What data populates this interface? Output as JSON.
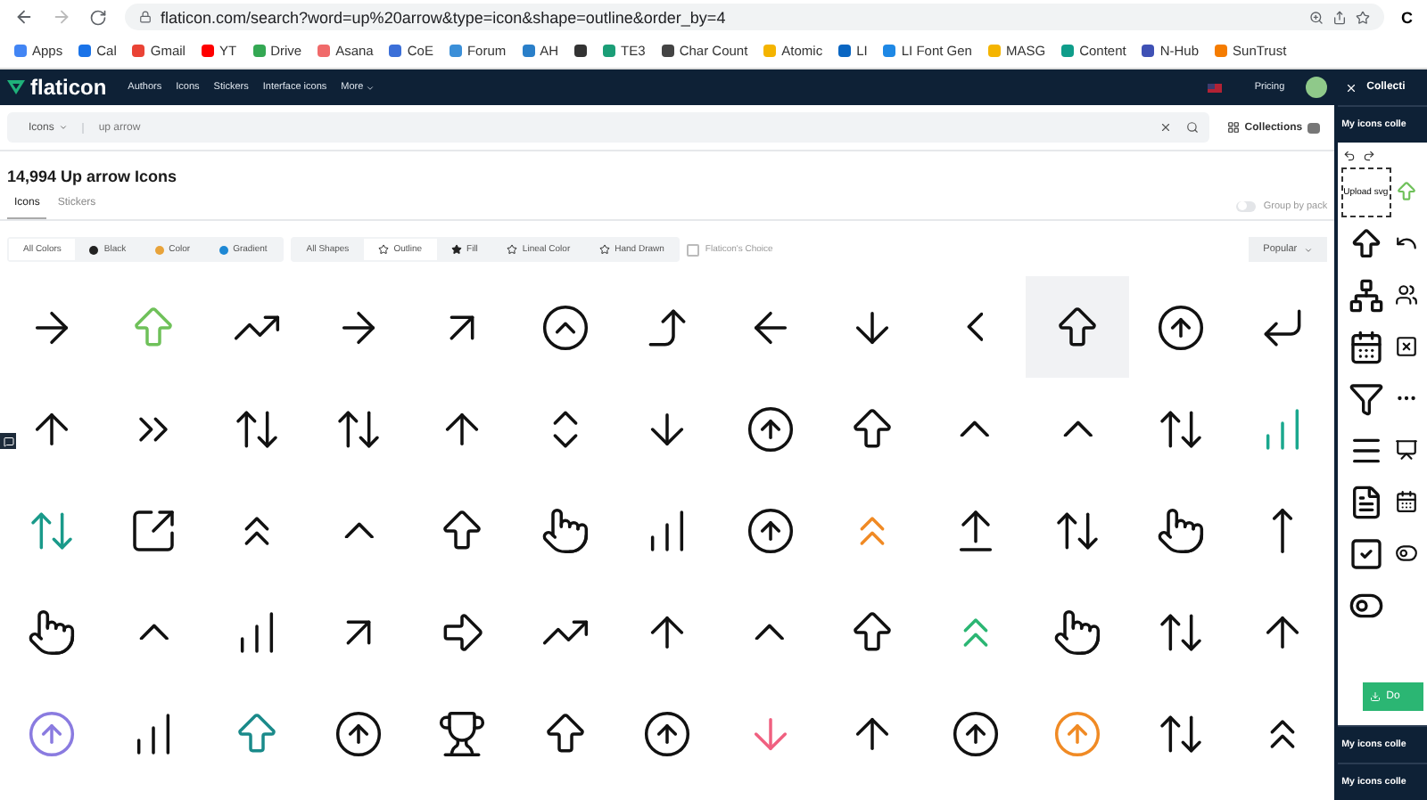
{
  "browser": {
    "url": "flaticon.com/search?word=up%20arrow&type=icon&shape=outline&order_by=4",
    "profile": "C",
    "bookmarks": [
      {
        "label": "Apps",
        "color": "#4285f4"
      },
      {
        "label": "Cal",
        "color": "#1a73e8"
      },
      {
        "label": "Gmail",
        "color": "#ea4335"
      },
      {
        "label": "YT",
        "color": "#ff0000"
      },
      {
        "label": "Drive",
        "color": "#34a853"
      },
      {
        "label": "Asana",
        "color": "#f06a6a"
      },
      {
        "label": "CoE",
        "color": "#3b6fd8"
      },
      {
        "label": "Forum",
        "color": "#3b8fd8"
      },
      {
        "label": "AH",
        "color": "#2a7fc9"
      },
      {
        "color": "#333333"
      },
      {
        "label": "TE3",
        "color": "#1b9e77"
      },
      {
        "label": "Char Count",
        "color": "#444444"
      },
      {
        "label": "Atomic",
        "color": "#f4b400"
      },
      {
        "label": "LI",
        "color": "#0a66c2"
      },
      {
        "label": "LI Font Gen",
        "color": "#1e88e5"
      },
      {
        "label": "MASG",
        "color": "#f4b400"
      },
      {
        "label": "Content",
        "color": "#0f9d8a"
      },
      {
        "label": "N-Hub",
        "color": "#3f51b5"
      },
      {
        "label": "SunTrust",
        "color": "#f57c00"
      }
    ]
  },
  "nav": {
    "logo": "flaticon",
    "links": [
      "Authors",
      "Icons",
      "Stickers",
      "Interface icons",
      "More"
    ],
    "pricing": "Pricing"
  },
  "search": {
    "type": "Icons",
    "value": "up arrow",
    "collections": "Collections"
  },
  "heading": "14,994 Up arrow Icons",
  "tabs": [
    {
      "label": "Icons",
      "selected": true
    },
    {
      "label": "Stickers",
      "selected": false
    }
  ],
  "group_by_pack": {
    "label": "Group by pack",
    "on": false
  },
  "color_filters": [
    {
      "label": "All Colors",
      "selected": true
    },
    {
      "label": "Black",
      "selected": false,
      "color": "#222222"
    },
    {
      "label": "Color",
      "selected": false,
      "color": "#e8a33a"
    },
    {
      "label": "Gradient",
      "selected": false,
      "color": "#1e88d4"
    }
  ],
  "shape_filters": [
    {
      "label": "All Shapes",
      "selected": false
    },
    {
      "label": "Outline",
      "selected": true,
      "kind": "star-outline"
    },
    {
      "label": "Fill",
      "selected": false,
      "kind": "star-fill"
    },
    {
      "label": "Lineal Color",
      "selected": false,
      "kind": "star-outline"
    },
    {
      "label": "Hand Drawn",
      "selected": false,
      "kind": "star-outline"
    }
  ],
  "flaticons_choice": {
    "label": "Flaticon's Choice",
    "checked": false
  },
  "sort": "Popular",
  "results": [
    {
      "kind": "arrow-right",
      "selected": false
    },
    {
      "kind": "big-up",
      "color": "#6fc15a",
      "selected": false
    },
    {
      "kind": "trend",
      "selected": false
    },
    {
      "kind": "arrow-right",
      "selected": false
    },
    {
      "kind": "diag",
      "selected": false
    },
    {
      "kind": "circle-chevron",
      "selected": false
    },
    {
      "kind": "swirl",
      "selected": false
    },
    {
      "kind": "arrow-left",
      "selected": false
    },
    {
      "kind": "arrow-down",
      "selected": false
    },
    {
      "kind": "chevron-left",
      "selected": false
    },
    {
      "kind": "big-up",
      "selected": true
    },
    {
      "kind": "circle-up",
      "selected": false
    },
    {
      "kind": "corner",
      "selected": false
    },
    {
      "kind": "arrow-up",
      "selected": false
    },
    {
      "kind": "chevrons-right",
      "selected": false
    },
    {
      "kind": "up-down",
      "selected": false
    },
    {
      "kind": "up-down",
      "selected": false
    },
    {
      "kind": "arrow-up",
      "selected": false
    },
    {
      "kind": "chevrons-up-down",
      "selected": false
    },
    {
      "kind": "arrow-down",
      "selected": false
    },
    {
      "kind": "circle-up",
      "selected": false
    },
    {
      "kind": "big-up",
      "selected": false
    },
    {
      "kind": "chevron-up",
      "selected": false
    },
    {
      "kind": "chevron-up",
      "selected": false
    },
    {
      "kind": "up-down",
      "selected": false
    },
    {
      "kind": "bars",
      "color": "#1aa88e",
      "selected": false
    },
    {
      "kind": "up-down",
      "color": "#1a9a8a",
      "selected": false
    },
    {
      "kind": "expand",
      "selected": false
    },
    {
      "kind": "chevrons-up",
      "selected": false
    },
    {
      "kind": "chevron-up",
      "selected": false
    },
    {
      "kind": "big-up",
      "selected": false
    },
    {
      "kind": "hand",
      "selected": false
    },
    {
      "kind": "bars",
      "selected": false
    },
    {
      "kind": "circle-up",
      "selected": false
    },
    {
      "kind": "chevrons-up",
      "color": "#f08a24",
      "selected": false
    },
    {
      "kind": "arrows-up",
      "selected": false
    },
    {
      "kind": "up-down",
      "selected": false
    },
    {
      "kind": "hand",
      "selected": false
    },
    {
      "kind": "line",
      "selected": false
    },
    {
      "kind": "hand",
      "selected": false
    },
    {
      "kind": "chevron-up",
      "selected": false
    },
    {
      "kind": "bars",
      "selected": false
    },
    {
      "kind": "diag",
      "selected": false
    },
    {
      "kind": "big-right",
      "selected": false
    },
    {
      "kind": "trend",
      "selected": false
    },
    {
      "kind": "arrow-up",
      "selected": false
    },
    {
      "kind": "chevron-up",
      "selected": false
    },
    {
      "kind": "big-up",
      "selected": false
    },
    {
      "kind": "chevrons-up",
      "color": "#2bb673",
      "selected": false
    },
    {
      "kind": "hand",
      "selected": false
    },
    {
      "kind": "up-down",
      "selected": false
    },
    {
      "kind": "arrow-up",
      "selected": false
    },
    {
      "kind": "circle-up",
      "color": "#8a7be0",
      "selected": false
    },
    {
      "kind": "bars",
      "selected": false
    },
    {
      "kind": "big-up",
      "color": "#1a8a8a",
      "selected": false
    },
    {
      "kind": "circle-up",
      "selected": false
    },
    {
      "kind": "trophy",
      "selected": false
    },
    {
      "kind": "big-up",
      "selected": false
    },
    {
      "kind": "circle-up",
      "selected": false
    },
    {
      "kind": "arrow-down",
      "color": "#f06080",
      "selected": false
    },
    {
      "kind": "arrow-up",
      "selected": false
    },
    {
      "kind": "circle-up",
      "selected": false
    },
    {
      "kind": "circle-up",
      "color": "#f08a24",
      "selected": false
    },
    {
      "kind": "up-down",
      "selected": false
    },
    {
      "kind": "chevrons-up",
      "selected": false
    }
  ],
  "panel": {
    "title": "Collecti",
    "collection": "My icons colle",
    "upload": "Upload svg",
    "download": "Do",
    "more_collections": [
      "My icons colle",
      "My icons colle"
    ],
    "icons": [
      {
        "kind": "big-up",
        "color": "#6fc15a"
      },
      {
        "kind": "big-up"
      },
      {
        "kind": "undo"
      },
      {
        "kind": "sitemap"
      },
      {
        "kind": "users"
      },
      {
        "kind": "calendar"
      },
      {
        "kind": "square-x"
      },
      {
        "kind": "filter"
      },
      {
        "kind": "dots"
      },
      {
        "kind": "menu"
      },
      {
        "kind": "presentation"
      },
      {
        "kind": "file"
      },
      {
        "kind": "calendar"
      },
      {
        "kind": "square-check"
      },
      {
        "kind": "toggle"
      },
      {
        "kind": "toggle"
      }
    ]
  }
}
